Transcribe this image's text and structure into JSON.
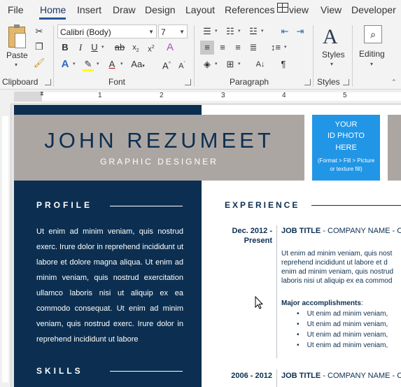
{
  "tabs": [
    "File",
    "Home",
    "Insert",
    "Draw",
    "Design",
    "Layout",
    "References",
    "view",
    "View",
    "Developer"
  ],
  "clipboard": {
    "paste_label": "Paste",
    "group": "Clipboard"
  },
  "font": {
    "family": "Calibri (Body)",
    "size": "7",
    "group": "Font"
  },
  "paragraph": {
    "group": "Paragraph"
  },
  "styles": {
    "label": "Styles",
    "group": "Styles"
  },
  "editing": {
    "label": "Editing"
  },
  "ruler": {
    "numbers": [
      "1",
      "2",
      "3",
      "4",
      "5"
    ]
  },
  "resume": {
    "name": "JOHN REZUMEET",
    "title": "GRAPHIC DESIGNER",
    "photo": {
      "line1": "YOUR",
      "line2": "ID PHOTO",
      "line3": "HERE",
      "hint1": "(Format > Fill > Picture",
      "hint2": "or texture fill)"
    },
    "profile_head": "PROFILE",
    "profile_text": "Ut enim ad minim veniam, quis nostrud exerc. Irure dolor in reprehend incididunt ut labore et dolore magna aliqua. Ut enim ad minim veniam, quis nostrud exercitation ullamco laboris nisi ut aliquip ex ea commodo consequat. Ut enim ad minim veniam, quis nostrud exerc. Irure dolor in reprehend incididunt ut labore",
    "skills_head": "SKILLS",
    "experience_head": "EXPERIENCE",
    "job1": {
      "date1": "Dec. 2012 -",
      "date2": "Present",
      "title": "JOB TITLE",
      "company": " - COMPANY NAME - CITY",
      "desc": [
        "Ut enim ad minim veniam, quis nost",
        "reprehend incididunt ut labore et d",
        "enim ad minim veniam, quis nostrud",
        "laboris nisi ut aliquip ex ea commod"
      ],
      "acc_head": "Major accomplishments",
      "bullets": [
        "Ut enim ad minim veniam,",
        "Ut enim ad minim veniam,",
        "Ut enim ad minim veniam,",
        "Ut enim ad minim veniam,"
      ]
    },
    "job2": {
      "date": "2006 - 2012",
      "title": "JOB TITLE",
      "company": " - COMPANY NAME - CITY"
    }
  }
}
